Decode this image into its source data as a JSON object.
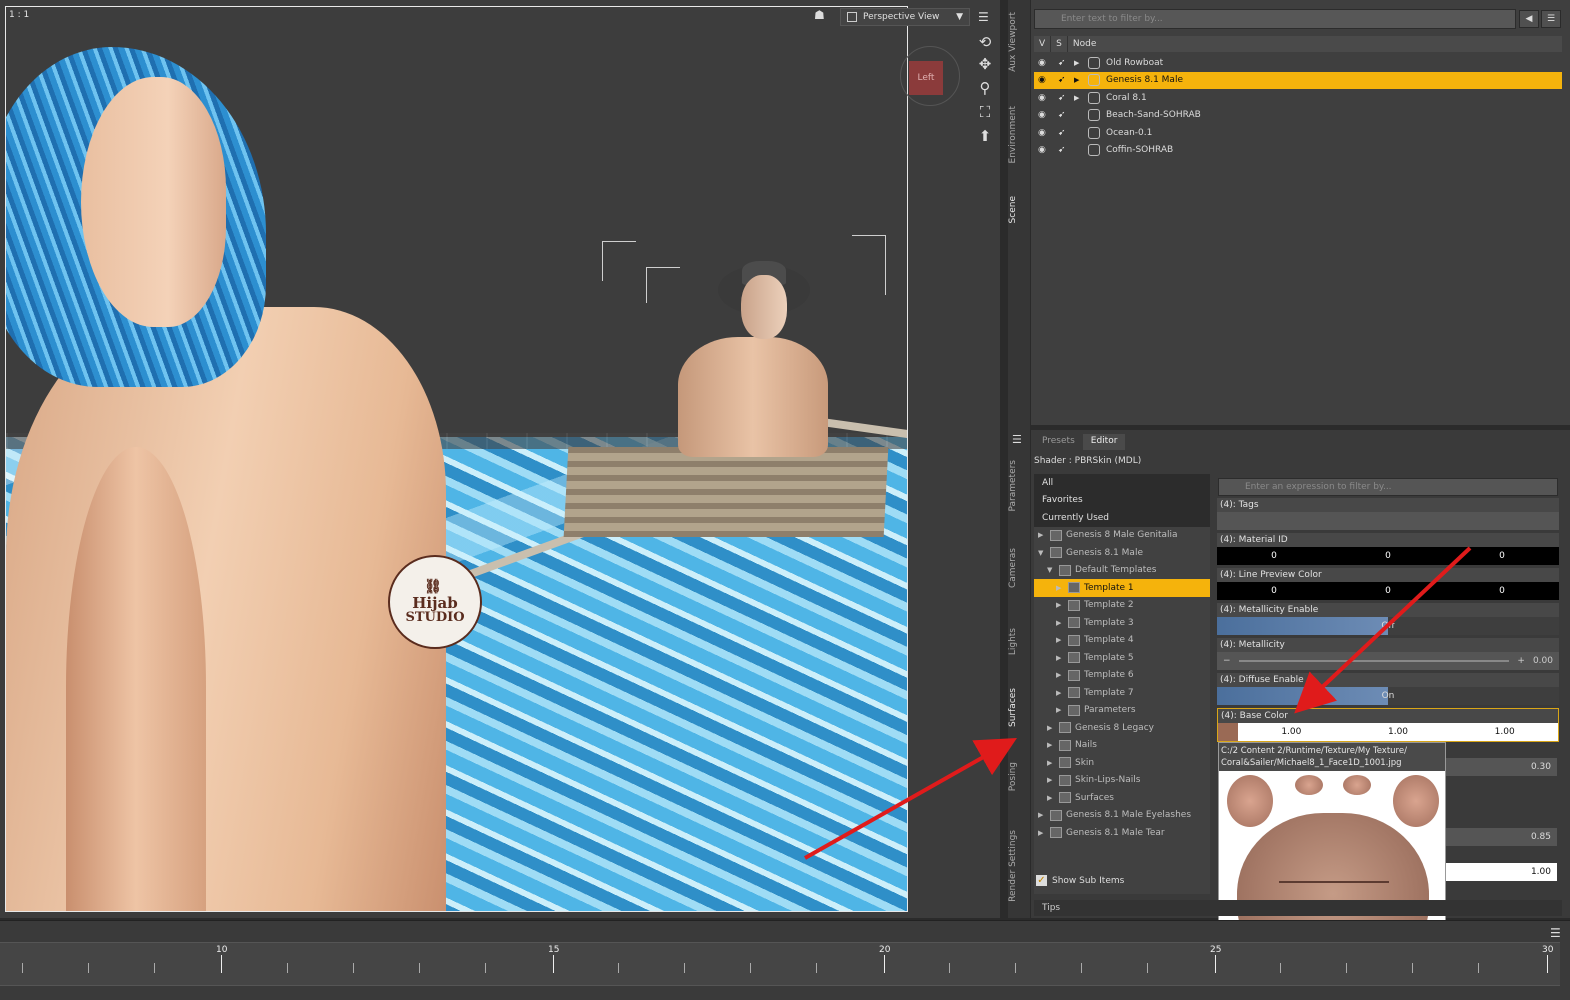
{
  "viewport": {
    "ratio": "1 : 1",
    "camera_select": "Perspective View",
    "view_cube_label": "Left",
    "watermark_line1": "Hijab",
    "watermark_line2": "STUDIO"
  },
  "side_tabs_top": [
    "Aux Viewport",
    "Environment",
    "Scene"
  ],
  "side_tabs_bottom": [
    "Parameters",
    "Cameras",
    "Lights",
    "Surfaces",
    "Posing",
    "Render Settings"
  ],
  "scene": {
    "filter_placeholder": "Enter text to filter by...",
    "columns": [
      "V",
      "S",
      "Node"
    ],
    "nodes": [
      {
        "name": "Old Rowboat",
        "selected": false,
        "expandable": true
      },
      {
        "name": "Genesis 8.1 Male",
        "selected": true,
        "expandable": true
      },
      {
        "name": "Coral 8.1",
        "selected": false,
        "expandable": true
      },
      {
        "name": "Beach-Sand-SOHRAB",
        "selected": false,
        "expandable": false
      },
      {
        "name": "Ocean-0.1",
        "selected": false,
        "expandable": false
      },
      {
        "name": "Coffin-SOHRAB",
        "selected": false,
        "expandable": false
      }
    ]
  },
  "surfaces": {
    "tabs": [
      "Presets",
      "Editor"
    ],
    "active_tab": "Editor",
    "shader_label": "Shader :  PBRSkin (MDL)",
    "tree_top": [
      "All",
      "Favorites",
      "Currently Used"
    ],
    "tree": [
      {
        "label": "Genesis 8 Male Genitalia",
        "indent": 0,
        "arrow": "▶",
        "selected": false
      },
      {
        "label": "Genesis 8.1 Male",
        "indent": 0,
        "arrow": "▼",
        "selected": false
      },
      {
        "label": "Default Templates",
        "indent": 1,
        "arrow": "▼",
        "selected": false
      },
      {
        "label": "Template 1",
        "indent": 2,
        "arrow": "▶",
        "selected": true
      },
      {
        "label": "Template 2",
        "indent": 2,
        "arrow": "▶",
        "selected": false
      },
      {
        "label": "Template 3",
        "indent": 2,
        "arrow": "▶",
        "selected": false
      },
      {
        "label": "Template 4",
        "indent": 2,
        "arrow": "▶",
        "selected": false
      },
      {
        "label": "Template 5",
        "indent": 2,
        "arrow": "▶",
        "selected": false
      },
      {
        "label": "Template 6",
        "indent": 2,
        "arrow": "▶",
        "selected": false
      },
      {
        "label": "Template 7",
        "indent": 2,
        "arrow": "▶",
        "selected": false
      },
      {
        "label": "Parameters",
        "indent": 2,
        "arrow": "▶",
        "selected": false
      },
      {
        "label": "Genesis 8 Legacy",
        "indent": 1,
        "arrow": "▶",
        "selected": false
      },
      {
        "label": "Nails",
        "indent": 1,
        "arrow": "▶",
        "selected": false
      },
      {
        "label": "Skin",
        "indent": 1,
        "arrow": "▶",
        "selected": false
      },
      {
        "label": "Skin-Lips-Nails",
        "indent": 1,
        "arrow": "▶",
        "selected": false
      },
      {
        "label": "Surfaces",
        "indent": 1,
        "arrow": "▶",
        "selected": false
      },
      {
        "label": "Genesis 8.1 Male Eyelashes",
        "indent": 0,
        "arrow": "▶",
        "selected": false
      },
      {
        "label": "Genesis 8.1 Male Tear",
        "indent": 0,
        "arrow": "▶",
        "selected": false
      }
    ],
    "show_sub_items": "Show Sub Items",
    "prop_filter_placeholder": "Enter an expression to filter by...",
    "props": {
      "tags": "(4): Tags",
      "material_id": "(4): Material ID",
      "material_id_values": [
        "0",
        "0",
        "0"
      ],
      "line_preview": "(4): Line Preview Color",
      "line_preview_values": [
        "0",
        "0",
        "0"
      ],
      "metallicity_enable": "(4): Metallicity Enable",
      "metallicity_enable_value": "Off",
      "metallicity": "(4): Metallicity",
      "metallicity_value": "0.00",
      "diffuse_enable": "(4): Diffuse Enable",
      "diffuse_enable_value": "On",
      "base_color": "(4): Base Color",
      "base_color_values": [
        "1.00",
        "1.00",
        "1.00"
      ]
    },
    "hidden_values": [
      "0.30",
      "0.85",
      "1.00"
    ],
    "texture_path_line1": "C:/2 Content 2/Runtime/Texture/My Texture/",
    "texture_path_line2": "Coral&Sailer/Michael8_1_Face1D_1001.jpg",
    "tips": "Tips"
  },
  "timeline": {
    "labels": [
      "10",
      "15",
      "20",
      "25",
      "30"
    ]
  },
  "colors": {
    "selection": "#f5b30c",
    "arrow": "#e01b1b"
  }
}
